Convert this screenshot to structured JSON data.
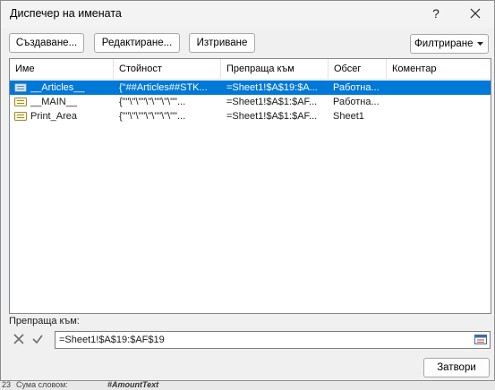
{
  "window": {
    "title": "Диспечер на имената",
    "help_label": "?"
  },
  "toolbar": {
    "new_label": "Създаване...",
    "edit_label": "Редактиране...",
    "delete_label": "Изтриване",
    "filter_label": "Филтриране"
  },
  "table": {
    "headers": {
      "name": "Име",
      "value": "Стойност",
      "refers_to": "Препраща към",
      "scope": "Обсег",
      "comment": "Коментар"
    },
    "rows": [
      {
        "name": "__Articles__",
        "value": "{\"##Articles##STK...",
        "refers_to": "=Sheet1!$A$19:$A...",
        "scope": "Работна...",
        "comment": "",
        "selected": true
      },
      {
        "name": "__MAIN__",
        "value": "{\"\"\\\"\\\"\"\\\"\\\"\"\\\"\\\"\"...",
        "refers_to": "=Sheet1!$A$1:$AF...",
        "scope": "Работна...",
        "comment": "",
        "selected": false
      },
      {
        "name": "Print_Area",
        "value": "{\"\"\\\"\\\"\"\\\"\\\"\"\\\"\\\"\"...",
        "refers_to": "=Sheet1!$A$1:$AF...",
        "scope": "Sheet1",
        "comment": "",
        "selected": false
      }
    ]
  },
  "refers_to": {
    "label": "Препраща към:",
    "value": "=Sheet1!$A$19:$AF$19"
  },
  "footer": {
    "close_label": "Затвори"
  },
  "background": {
    "row_number": "23",
    "cell_a": "Сума словом:",
    "cell_b": "#AmountText"
  },
  "colors": {
    "selection": "#0078d7",
    "dialog_bg": "#f0f0f0",
    "name_icon": "#5b8fc7"
  },
  "icons": [
    "close-icon",
    "help-icon",
    "dropdown-arrow-icon",
    "name-icon",
    "cancel-x-icon",
    "confirm-check-icon",
    "collapse-dialog-icon"
  ]
}
